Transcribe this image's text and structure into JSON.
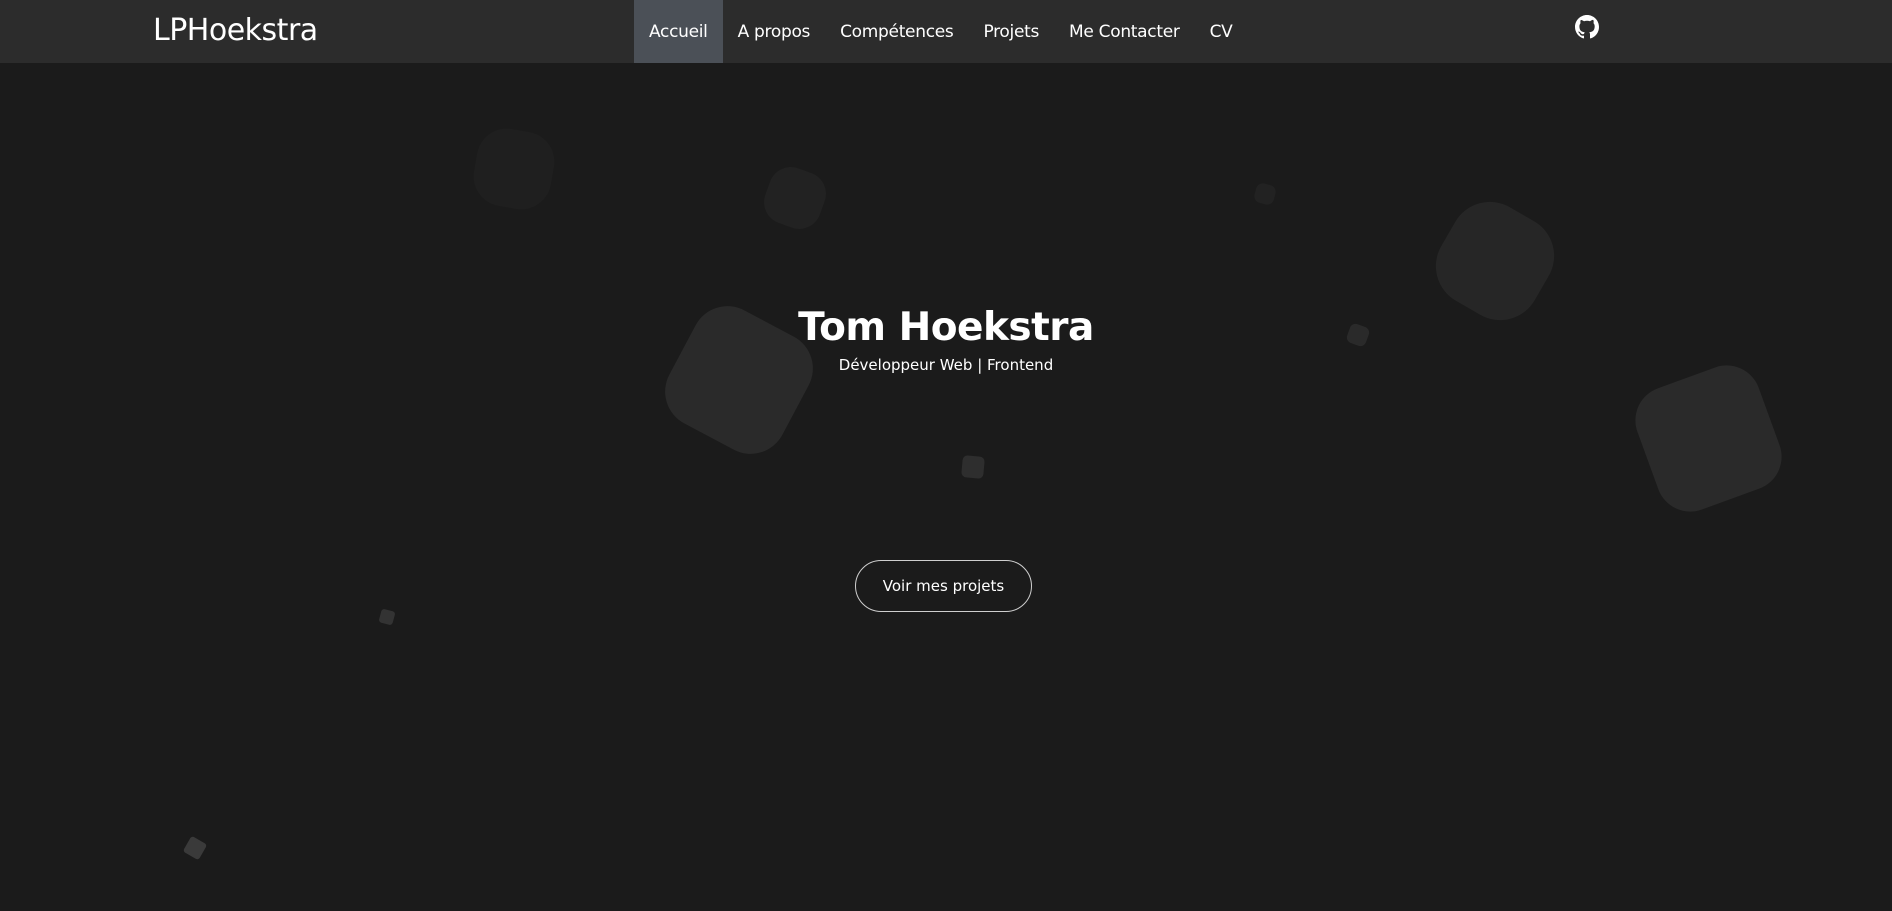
{
  "navbar": {
    "brand": "LPHoekstra",
    "links": [
      {
        "label": "Accueil",
        "active": true
      },
      {
        "label": "A propos",
        "active": false
      },
      {
        "label": "Compétences",
        "active": false
      },
      {
        "label": "Projets",
        "active": false
      },
      {
        "label": "Me Contacter",
        "active": false
      },
      {
        "label": "CV",
        "active": false
      }
    ],
    "github_icon": "github-icon"
  },
  "hero": {
    "title": "Tom Hoekstra",
    "subtitle": "Développeur Web | Frontend",
    "cta_label": "Voir mes projets"
  },
  "colors": {
    "background": "#1b1b1b",
    "navbar": "#2c2c2c",
    "active_tab": "#4b5057",
    "shape": "#2a2a2a"
  }
}
